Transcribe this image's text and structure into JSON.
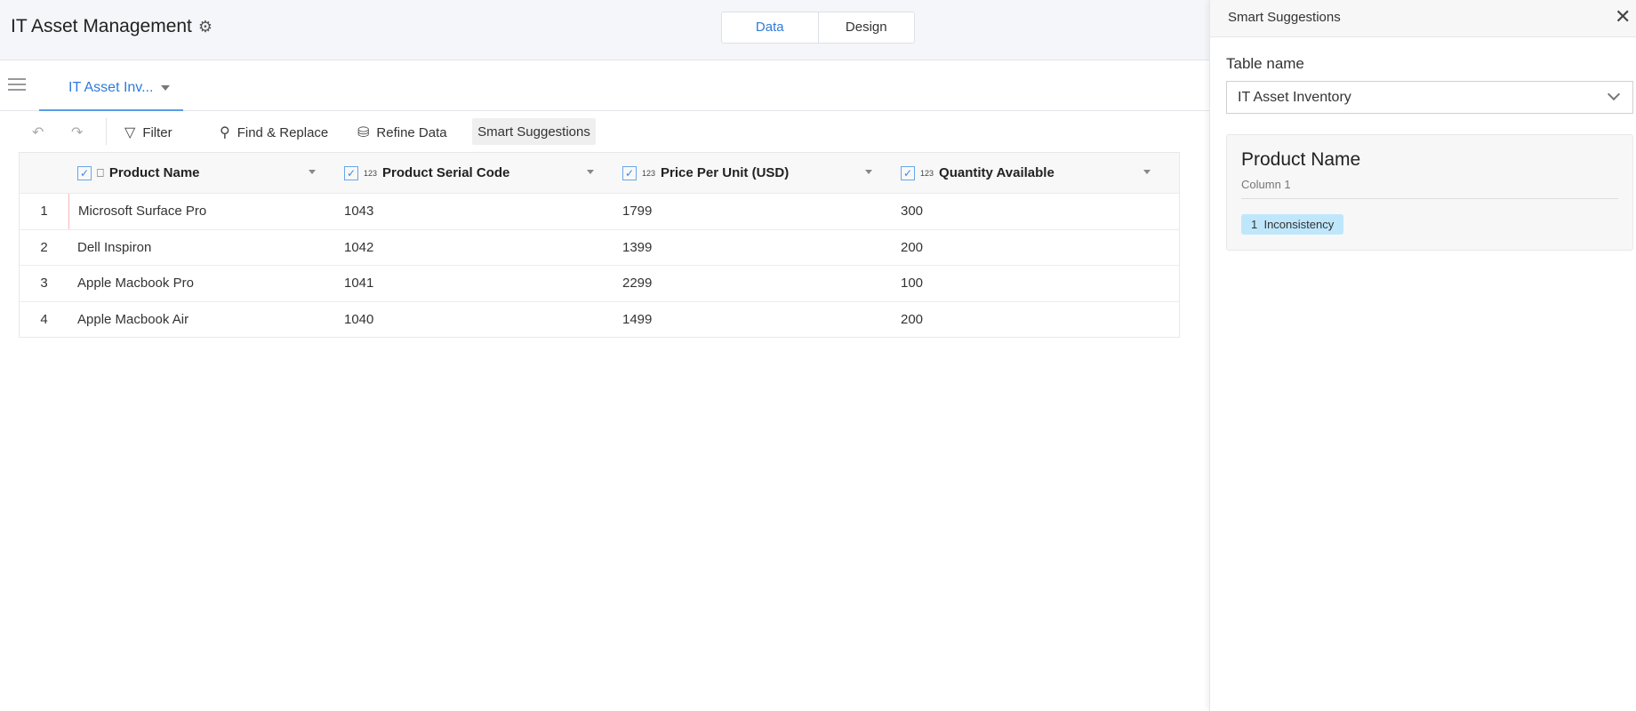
{
  "header": {
    "title": "IT Asset Management",
    "tabs": [
      "Data",
      "Design"
    ],
    "active_tab": "Data"
  },
  "sheet_tab": {
    "label": "IT Asset Inv..."
  },
  "toolbar": {
    "filter": "Filter",
    "find_replace": "Find & Replace",
    "refine": "Refine Data",
    "smart": "Smart Suggestions"
  },
  "table": {
    "columns": [
      {
        "name": "Product Name",
        "type": "text"
      },
      {
        "name": "Product Serial Code",
        "type": "123"
      },
      {
        "name": "Price Per Unit (USD)",
        "type": "123"
      },
      {
        "name": "Quantity Available",
        "type": "123"
      }
    ],
    "rows": [
      {
        "n": "1",
        "cells": [
          "Microsoft Surface Pro",
          "1043",
          "1799",
          "300"
        ]
      },
      {
        "n": "2",
        "cells": [
          "Dell Inspiron",
          "1042",
          "1399",
          "200"
        ]
      },
      {
        "n": "3",
        "cells": [
          "Apple Macbook Pro",
          "1041",
          "2299",
          "100"
        ]
      },
      {
        "n": "4",
        "cells": [
          "Apple Macbook Air",
          "1040",
          "1499",
          "200"
        ]
      }
    ]
  },
  "panel": {
    "title": "Smart Suggestions",
    "table_label": "Table name",
    "table_value": "IT Asset Inventory",
    "card": {
      "title": "Product Name",
      "subtitle": "Column 1",
      "badge": "1  Inconsistency"
    }
  },
  "colors": {
    "accent": "#2f7bd9",
    "badge": "#bfe7fb"
  }
}
